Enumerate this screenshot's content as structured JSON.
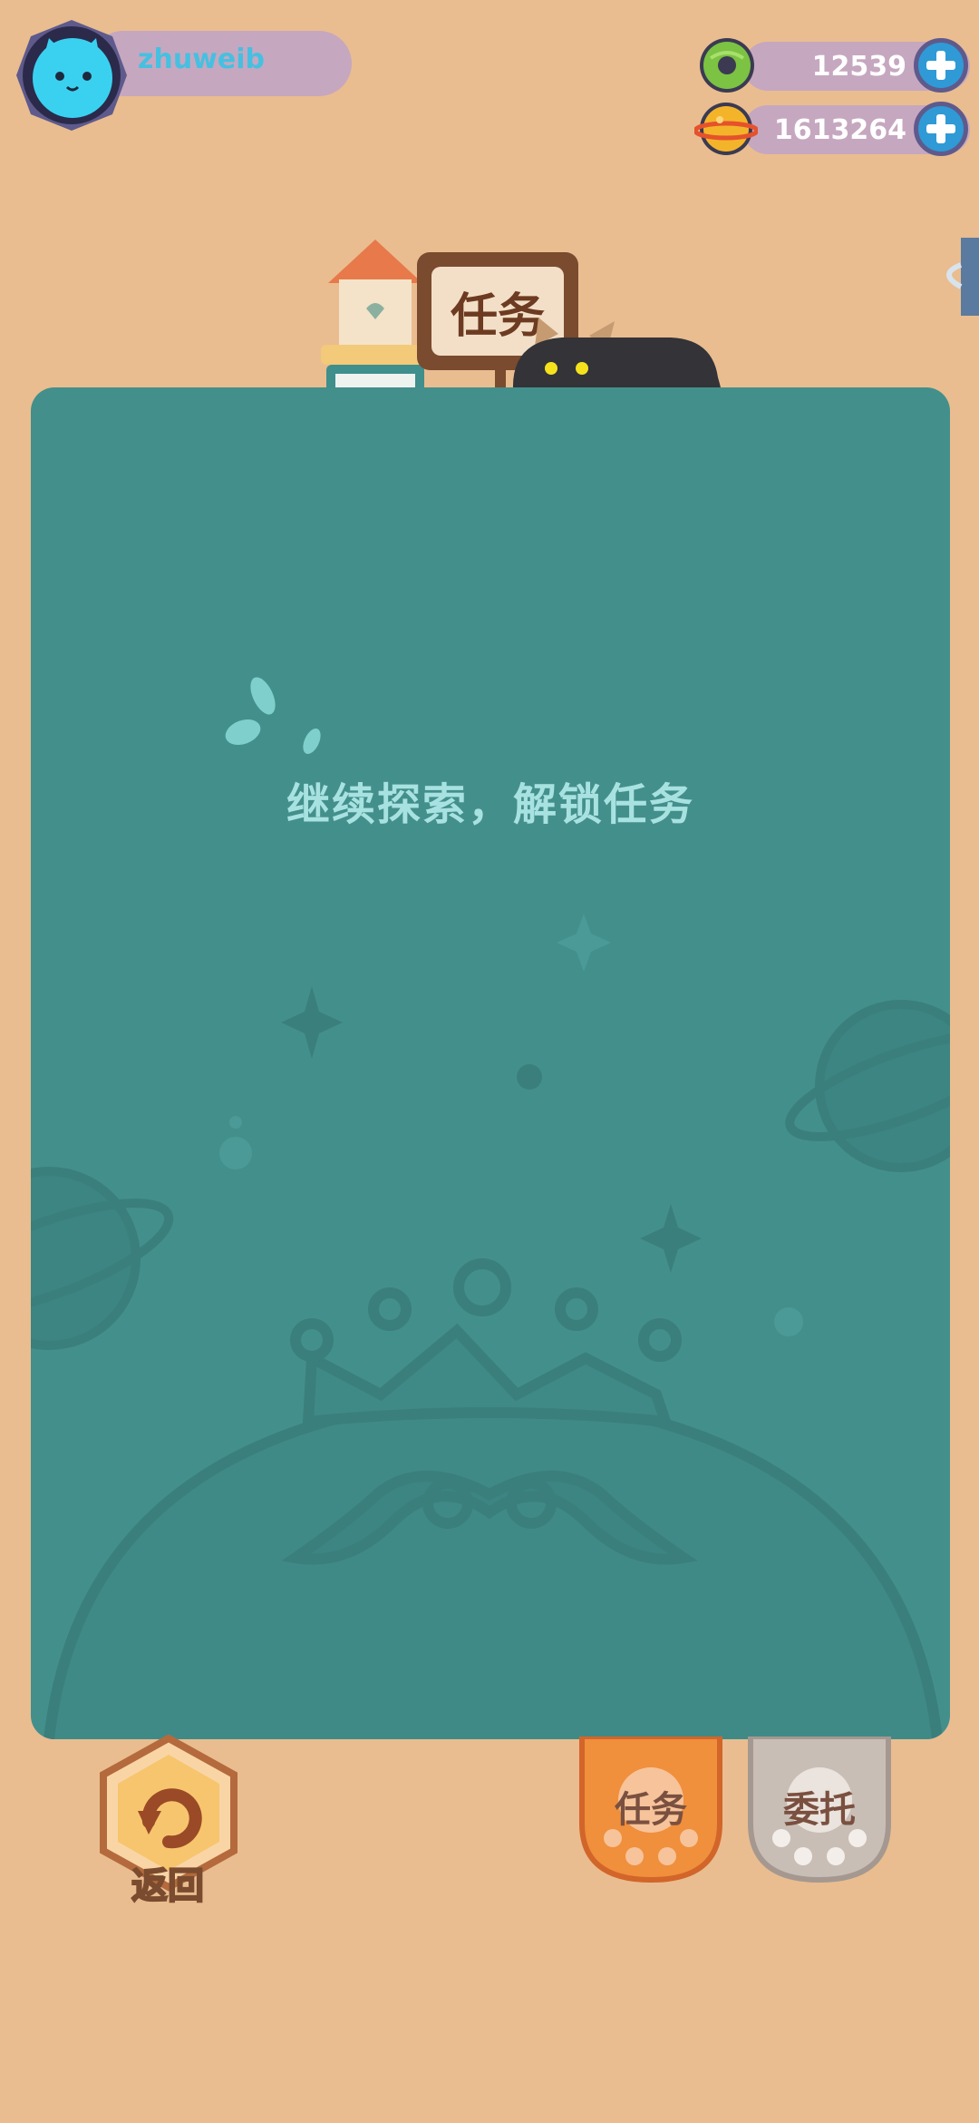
{
  "profile": {
    "username": "zhuweib",
    "avatar_icon": "cat-face-icon"
  },
  "currencies": [
    {
      "icon": "green-donut-icon",
      "value": "12539",
      "color": "#7cc243"
    },
    {
      "icon": "gold-planet-coin-icon",
      "value": "1613264",
      "color": "#f4b42a"
    }
  ],
  "header": {
    "sign_label": "任务"
  },
  "panel": {
    "message": "继续探索，解锁任务",
    "background": "#438f8c"
  },
  "bottom": {
    "back_label": "返回",
    "tabs": [
      {
        "label": "任务",
        "active": true,
        "color": "#f08f3c"
      },
      {
        "label": "委托",
        "active": false,
        "color": "#c9beb6"
      }
    ]
  },
  "colors": {
    "page_background": "#e9bd8f",
    "accent_blue": "#2f9ad6"
  }
}
